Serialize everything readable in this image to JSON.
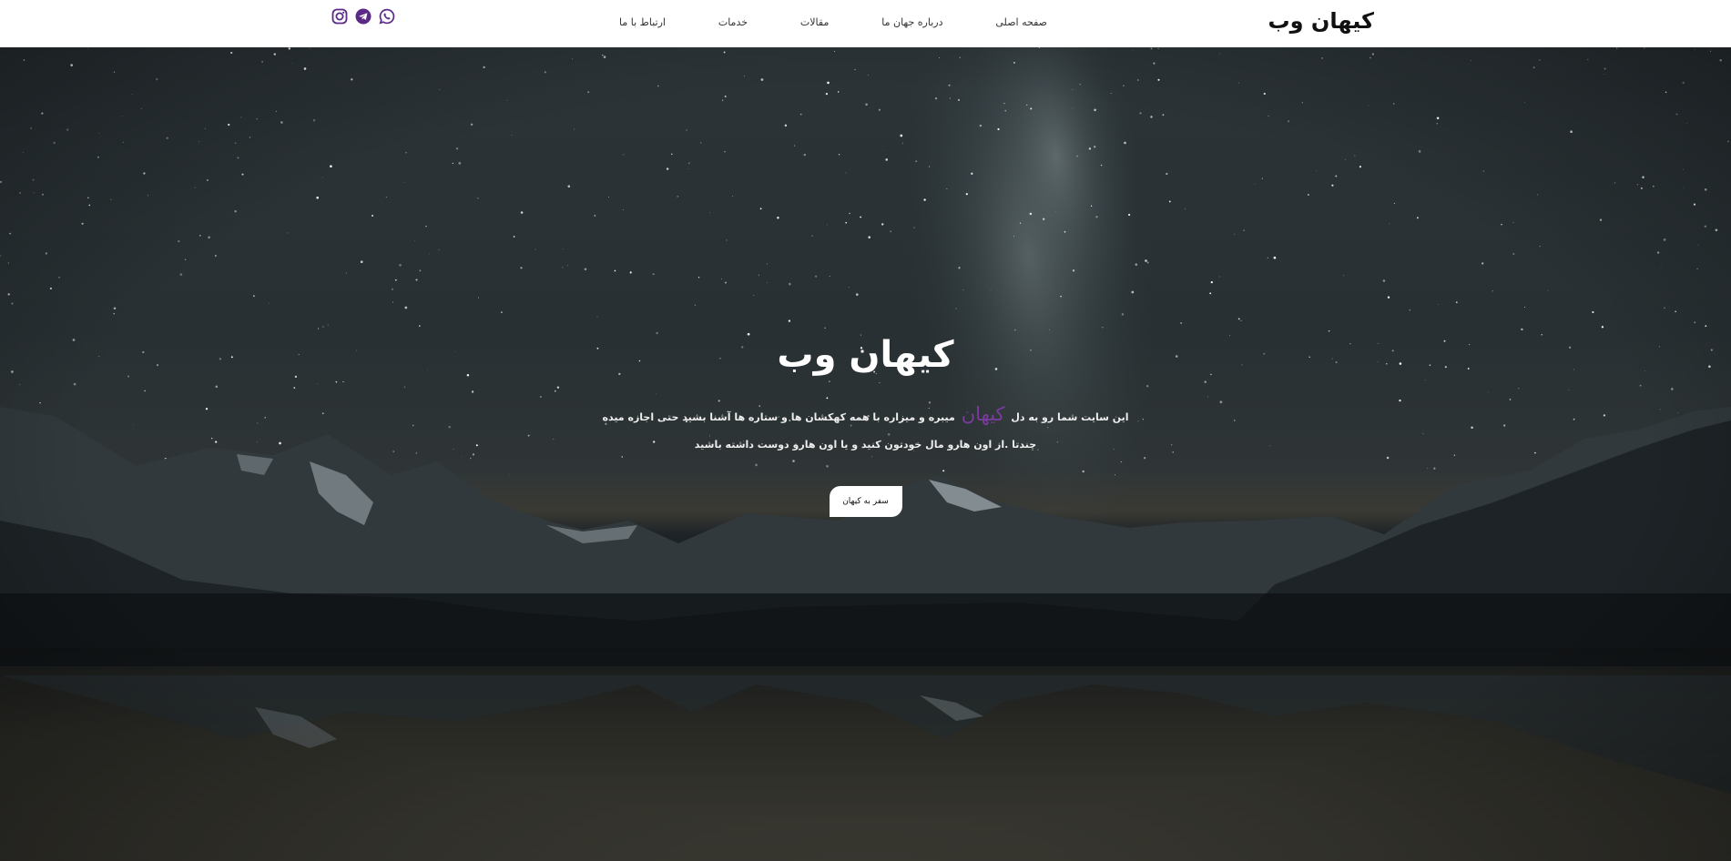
{
  "header": {
    "logo": "کیهان وب",
    "nav": [
      {
        "label": "صفحه اصلی"
      },
      {
        "label": "درباره جهان ما"
      },
      {
        "label": "مقالات"
      },
      {
        "label": "خدمات"
      },
      {
        "label": "ارتباط با ما"
      }
    ],
    "social": [
      "whatsapp-icon",
      "telegram-icon",
      "instagram-icon"
    ],
    "accent_color": "#5b2a86"
  },
  "hero": {
    "title": "کیهان وب",
    "text_before": "این سایت شما رو به دل",
    "highlight": "کیهان",
    "text_after": "میبره و میزاره با همه کهکشان ها و ستاره ها آشنا بشید حتی اجازه میده چندتا .از اون هارو مال خودتون کنید و یا اون هارو دوست داشته باشید",
    "button_label": "سفر به کیهان",
    "highlight_color": "#7a3b9e",
    "background": "night-sky-mountains-lake"
  }
}
